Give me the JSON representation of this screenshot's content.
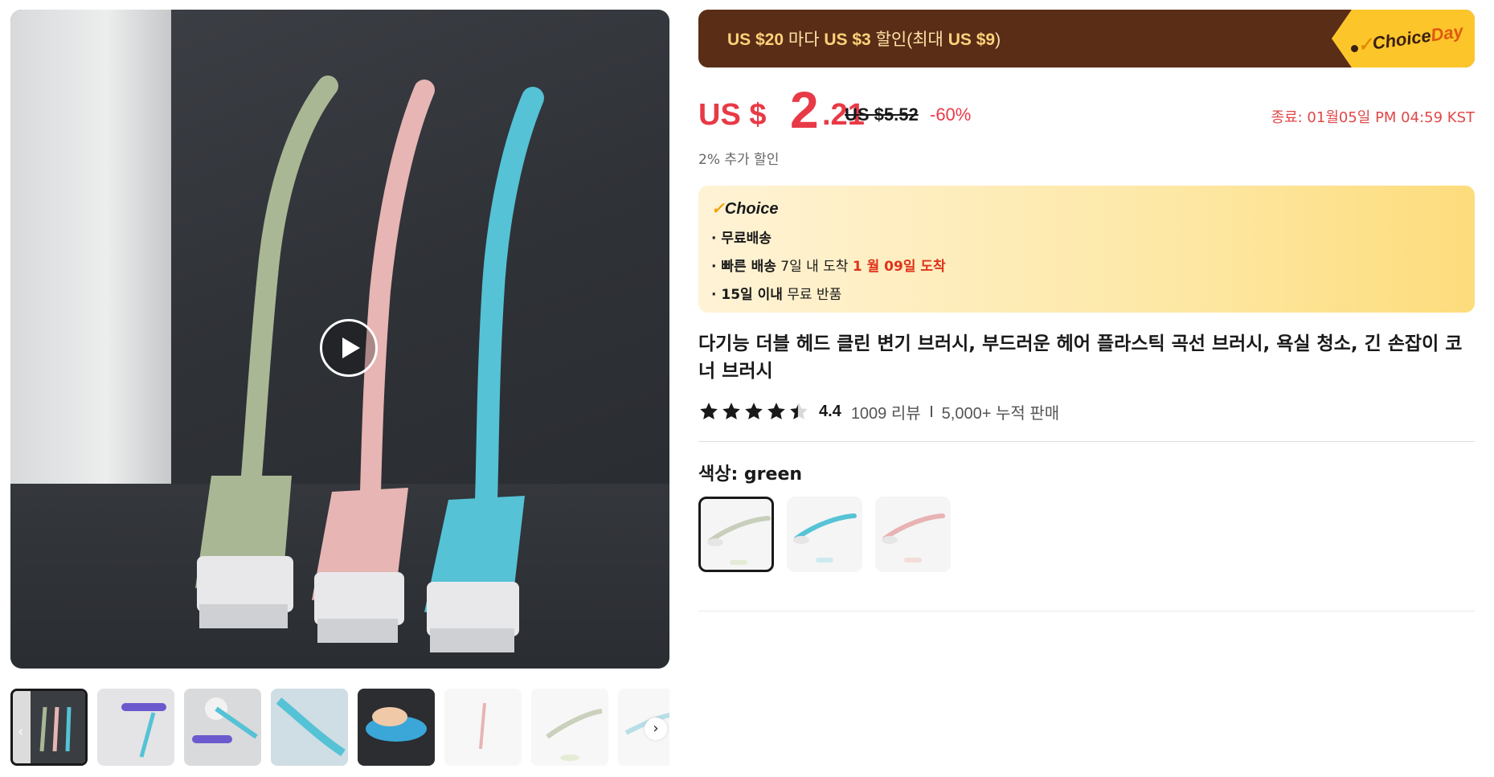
{
  "gallery": {
    "play_icon": "play-icon",
    "prev_icon": "chevron-left-icon",
    "next_icon": "chevron-right-icon",
    "prev_glyph": "‹",
    "next_glyph": "›"
  },
  "promo": {
    "text_prefix": "US $20",
    "text_mid1": " 마다 ",
    "text_amount": "US $3",
    "text_mid2": " 할인(최대 ",
    "text_max": "US $9",
    "text_suffix": ")",
    "tag_check": "✓",
    "tag_choice": "Choice",
    "tag_day": "Day"
  },
  "price": {
    "prefix": "US $",
    "whole": "2",
    "cents": ".21",
    "original": "US $5.52",
    "discount": "-60%",
    "end_time": "종료: 01월05일 PM 04:59 KST",
    "extra_discount": "2% 추가 할인"
  },
  "choice": {
    "check": "✓",
    "logo": "Choice",
    "line1_strong": "· 무료배송",
    "line2_strong": "· 빠른 배송",
    "line2_text": " 7일 내 도착 ",
    "line2_red": "1 월 09일 도착",
    "line3_strong": "· 15일 이내",
    "line3_text": "  무료 반품"
  },
  "product": {
    "title": "다기능 더블 헤드 클린 변기 브러시, 부드러운 헤어 플라스틱 곡선 브러시, 욕실 청소, 긴 손잡이 코너 브러시",
    "rating": "4.4",
    "reviews": "1009 리뷰",
    "sold": "5,000+ 누적 판매",
    "color_label": "색상: green"
  },
  "colors": {
    "green": "#aab896",
    "pink": "#e8b3b3",
    "blue": "#56c3d6",
    "accent_red": "#e83a46",
    "promo_bg": "#5a2d17"
  }
}
